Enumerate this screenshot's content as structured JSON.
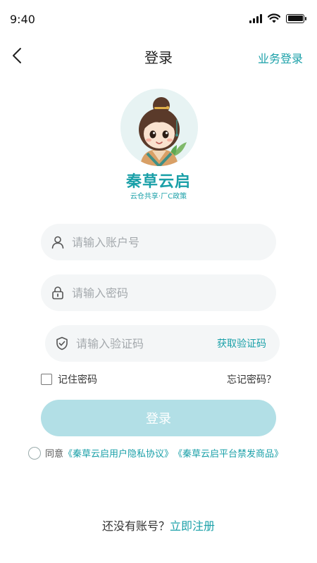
{
  "status_bar": {
    "time": "9:40"
  },
  "nav": {
    "title": "登录",
    "right_link": "业务登录"
  },
  "brand": {
    "name": "秦草云启",
    "slogan": "云仓共享·厂C政策"
  },
  "form": {
    "account_placeholder": "请输入账户号",
    "password_placeholder": "请输入密码",
    "code_placeholder": "请输入验证码",
    "get_code_label": "获取验证码",
    "remember_label": "记住密码",
    "forgot_label": "忘记密码？",
    "login_label": "登录"
  },
  "agreement": {
    "prefix": "同意",
    "privacy_link": "《秦草云启用户隐私协议》",
    "forbidden_link": "《秦草云启平台禁发商品》"
  },
  "register": {
    "prompt": "还没有账号？",
    "link": "立即注册"
  },
  "colors": {
    "accent": "#1aa0a8",
    "button_disabled": "#b2dfe6",
    "input_bg": "#f4f6f7"
  }
}
